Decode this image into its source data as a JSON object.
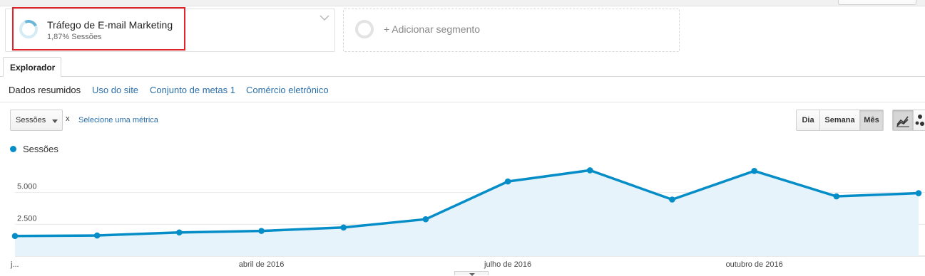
{
  "segments": {
    "active": {
      "name": "Tráfego de E-mail Marketing",
      "subtitle": "1,87% Sessões"
    },
    "add_label": "+ Adicionar segmento"
  },
  "tabs": {
    "explorer": "Explorador"
  },
  "subnav": {
    "items": [
      "Dados resumidos",
      "Uso do site",
      "Conjunto de metas 1",
      "Comércio eletrônico"
    ],
    "active_index": 0
  },
  "controls": {
    "metric_select": "Sessões",
    "remove_metric": "x",
    "select_metric_link": "Selecione uma métrica",
    "period_buttons": [
      "Dia",
      "Semana",
      "Mês"
    ],
    "period_selected": "Mês",
    "chart_type_icons": [
      "line-chart-icon",
      "motion-chart-icon"
    ]
  },
  "colors": {
    "series": "#058dc7",
    "area_fill": "#e6f3fa",
    "highlight_box": "#e0242b",
    "link": "#2a6ea8"
  },
  "chart_data": {
    "type": "area",
    "series": [
      {
        "name": "Sessões",
        "values": [
          1580,
          1620,
          1860,
          1980,
          2250,
          2900,
          5870,
          6750,
          4450,
          6700,
          4700,
          4950
        ]
      }
    ],
    "ylim": [
      0,
      7500
    ],
    "yticks": [
      {
        "value": 2500,
        "label": "2.500"
      },
      {
        "value": 5000,
        "label": "5.000"
      }
    ],
    "xticks": [
      {
        "index": 0,
        "label": "j..."
      },
      {
        "index": 3,
        "label": "abril de 2016"
      },
      {
        "index": 6,
        "label": "julho de 2016"
      },
      {
        "index": 9,
        "label": "outubro de 2016"
      }
    ],
    "grid": true,
    "legend_position": "top-left"
  }
}
